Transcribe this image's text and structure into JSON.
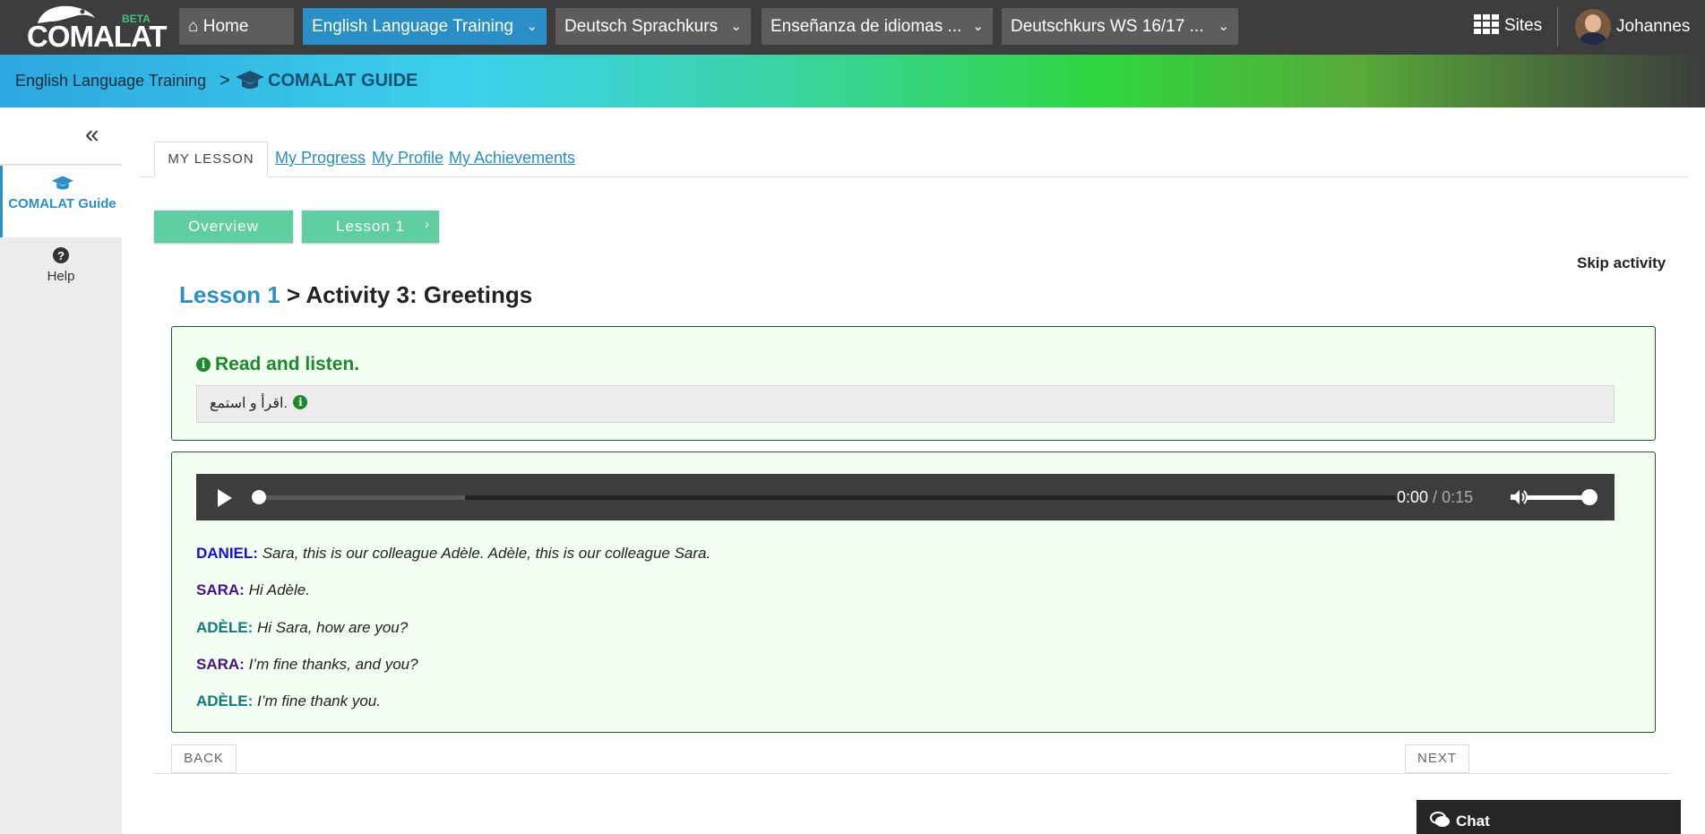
{
  "topbar": {
    "logo_text": "COMALAT",
    "logo_badge": "BETA",
    "tabs": [
      {
        "label": "Home",
        "icon": "home-icon"
      },
      {
        "label": "English Language Training",
        "active": true
      },
      {
        "label": "Deutsch Sprachkurs"
      },
      {
        "label": "Enseñanza de idiomas ..."
      },
      {
        "label": "Deutschkurs WS 16/17 ..."
      }
    ],
    "sites_label": "Sites",
    "user_name": "Johannes"
  },
  "breadcrumb": {
    "site": "English Language Training",
    "separator": ">",
    "tool": "COMALAT GUIDE"
  },
  "sidebar": {
    "collapse_glyph": "«",
    "items": [
      {
        "label": "COMALAT Guide",
        "icon": "graduation-cap-icon",
        "active": true
      },
      {
        "label": "Help",
        "icon": "question-circle-icon"
      }
    ]
  },
  "tabs": {
    "active": "MY LESSON",
    "links": [
      "My Progress",
      "My Profile",
      "My Achievements"
    ]
  },
  "nav_buttons": {
    "overview": "Overview",
    "lesson": "Lesson 1"
  },
  "skip_label": "Skip activity",
  "heading": {
    "lesson": "Lesson 1",
    "separator": ">",
    "activity": "Activity 3: Greetings"
  },
  "instruction": {
    "title": "Read and listen.",
    "translation": "اقرأ و استمع."
  },
  "audio": {
    "current_time": "0:00",
    "separator": " / ",
    "duration": "0:15",
    "progress": 0,
    "buffered": 0.18,
    "volume": 1.0
  },
  "dialogue": [
    {
      "speaker": "DANIEL:",
      "text": "Sara, this is our colleague Adèle. Adèle, this is our colleague Sara.",
      "color": "#1010e0"
    },
    {
      "speaker": "SARA:",
      "text": "Hi Adèle.",
      "color": "#4b0f86"
    },
    {
      "speaker": "ADÈLE:",
      "text": "Hi Sara, how are you?",
      "color": "#117a7a"
    },
    {
      "speaker": "SARA:",
      "text": "I’m fine thanks, and you?",
      "color": "#4b0f86"
    },
    {
      "speaker": "ADÈLE:",
      "text": "I’m fine thank you.",
      "color": "#117a7a"
    }
  ],
  "pager": {
    "back": "BACK",
    "next": "NEXT"
  },
  "chat_label": "Chat",
  "colors": {
    "accent": "#2a8fc6",
    "topbar": "#3d3d3d",
    "pill": "#5fcfa2",
    "instruction_green": "#1a8a2a"
  }
}
